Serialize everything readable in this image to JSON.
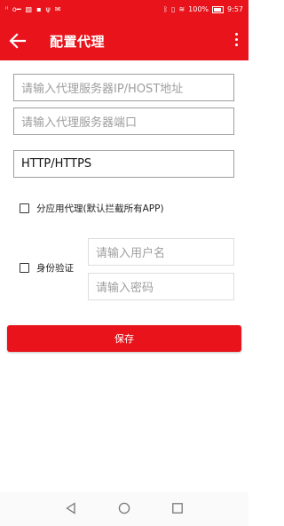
{
  "status_bar": {
    "left_icons": [
      "signal-icon",
      "key-icon",
      "image-icon",
      "app-icon",
      "usb-icon",
      "mail-icon"
    ],
    "battery_percent": "100%",
    "time": "9:57"
  },
  "toolbar": {
    "title": "配置代理",
    "color": "#e8131b"
  },
  "form": {
    "host_placeholder": "请输入代理服务器IP/HOST地址",
    "port_placeholder": "请输入代理服务器端口",
    "protocol_value": "HTTP/HTTPS",
    "per_app_label": "分应用代理(默认拦截所有APP)",
    "auth_label": "身份验证",
    "username_placeholder": "请输入用户名",
    "password_placeholder": "请输入密码"
  },
  "save_label": "保存"
}
